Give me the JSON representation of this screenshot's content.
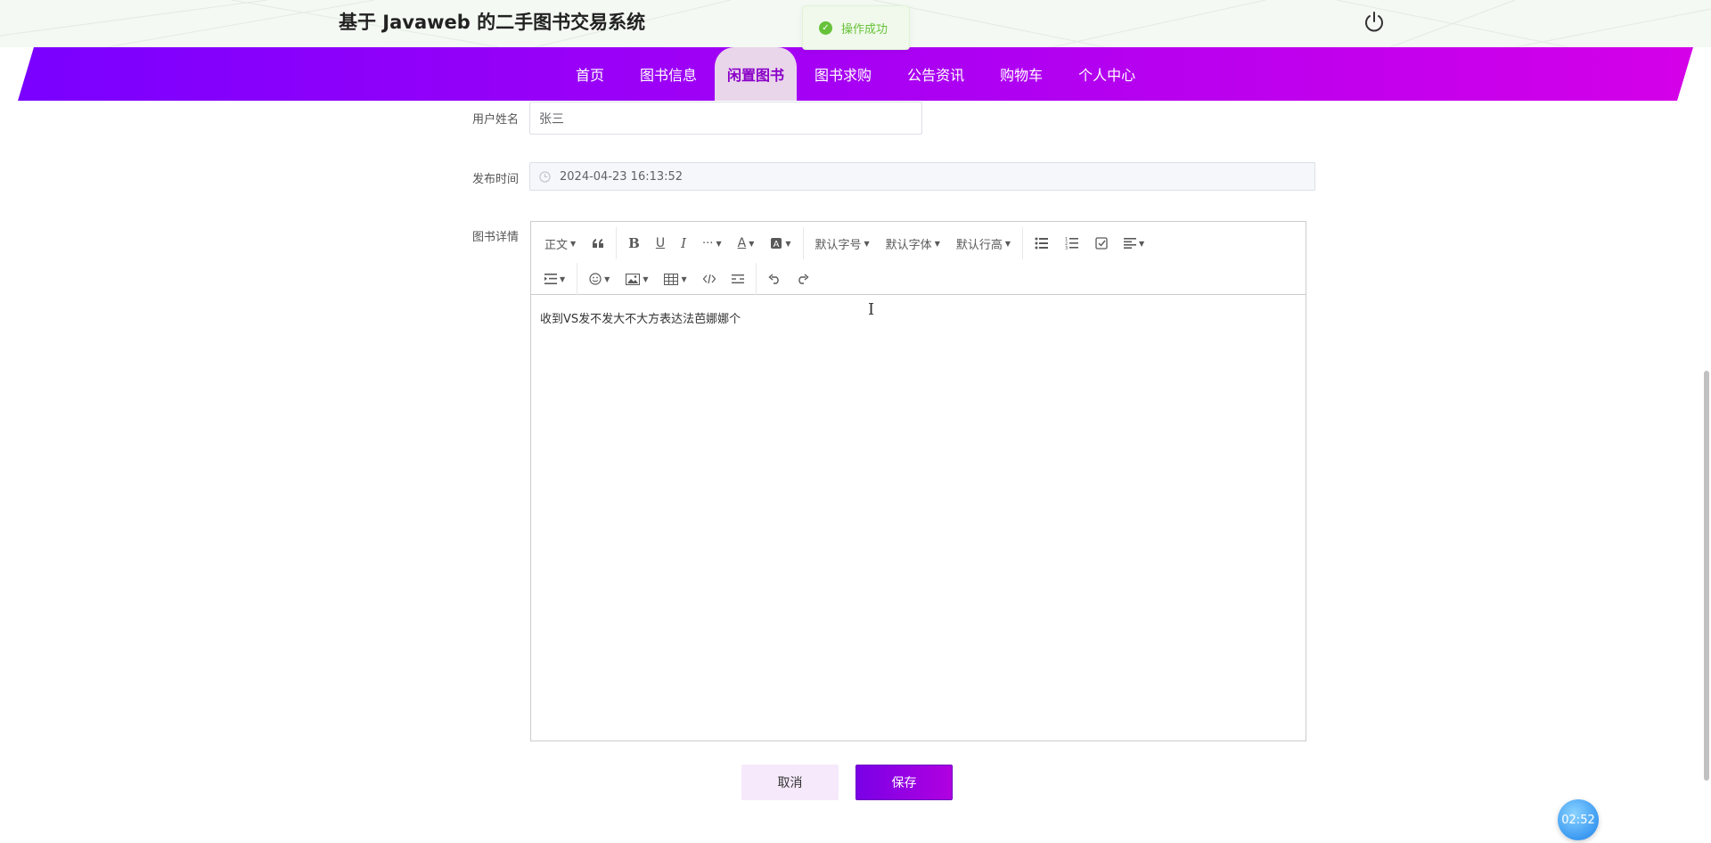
{
  "header": {
    "site_title": "基于 Javaweb 的二手图书交易系统",
    "power_icon": "power-icon"
  },
  "toast": {
    "message": "操作成功",
    "type": "success",
    "color": "#67c23a"
  },
  "nav": {
    "items": [
      {
        "label": "首页",
        "active": false
      },
      {
        "label": "图书信息",
        "active": false
      },
      {
        "label": "闲置图书",
        "active": true
      },
      {
        "label": "图书求购",
        "active": false
      },
      {
        "label": "公告资讯",
        "active": false
      },
      {
        "label": "购物车",
        "active": false
      },
      {
        "label": "个人中心",
        "active": false
      }
    ],
    "gradient_start": "#7a00ff",
    "gradient_end": "#d400e8"
  },
  "form": {
    "username_label": "用户姓名",
    "username_value": "张三",
    "publish_time_label": "发布时间",
    "publish_time_value": "2024-04-23 16:13:52",
    "detail_label": "图书详情",
    "detail_content": "收到VS发不发大不大方表达法芭娜娜个"
  },
  "editor_toolbar": {
    "row1": [
      {
        "type": "dropdown",
        "label": "正文",
        "name": "paragraph-format"
      },
      {
        "type": "icon",
        "name": "quote-icon"
      },
      {
        "type": "icon",
        "name": "bold-icon"
      },
      {
        "type": "icon",
        "name": "underline-icon"
      },
      {
        "type": "icon",
        "name": "italic-icon"
      },
      {
        "type": "dropdown",
        "label": "···",
        "name": "more-style"
      },
      {
        "type": "icon-dropdown",
        "name": "font-color-icon"
      },
      {
        "type": "icon-dropdown",
        "name": "bg-color-icon"
      },
      {
        "type": "dropdown",
        "label": "默认字号",
        "name": "font-size"
      },
      {
        "type": "dropdown",
        "label": "默认字体",
        "name": "font-family"
      },
      {
        "type": "dropdown",
        "label": "默认行高",
        "name": "line-height"
      },
      {
        "type": "icon",
        "name": "bulleted-list-icon"
      },
      {
        "type": "icon",
        "name": "numbered-list-icon"
      },
      {
        "type": "icon",
        "name": "todo-icon"
      },
      {
        "type": "icon-dropdown",
        "name": "align-icon"
      }
    ],
    "row2": [
      {
        "type": "icon-dropdown",
        "name": "indent-icon"
      },
      {
        "type": "icon-dropdown",
        "name": "emoji-icon"
      },
      {
        "type": "icon-dropdown",
        "name": "image-icon"
      },
      {
        "type": "icon-dropdown",
        "name": "table-icon"
      },
      {
        "type": "icon",
        "name": "code-icon"
      },
      {
        "type": "icon",
        "name": "divider-icon"
      },
      {
        "type": "icon",
        "name": "undo-icon"
      },
      {
        "type": "icon",
        "name": "redo-icon"
      }
    ]
  },
  "buttons": {
    "cancel": "取消",
    "save": "保存"
  },
  "timer": {
    "value": "02:52"
  }
}
